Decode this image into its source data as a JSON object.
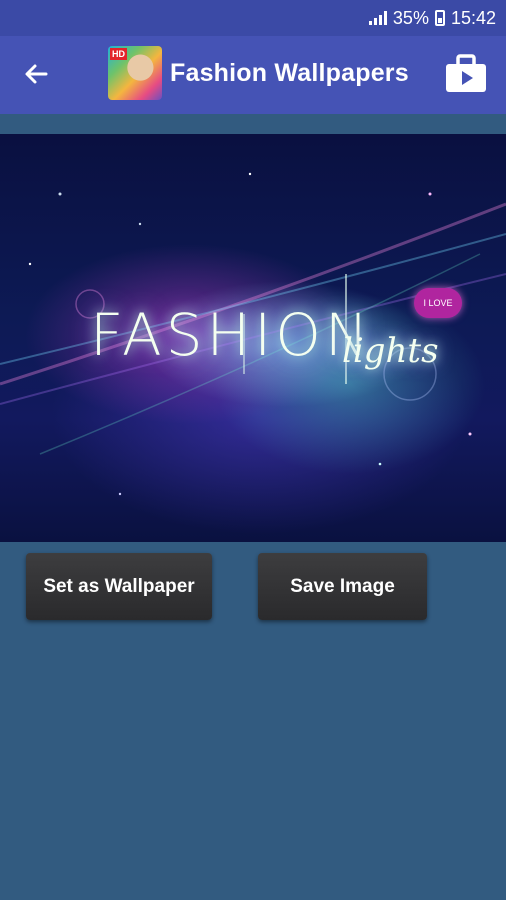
{
  "status_bar": {
    "battery": "35%",
    "time": "15:42"
  },
  "app_bar": {
    "title": "Fashion Wallpapers",
    "logo_badge": "HD"
  },
  "wallpaper": {
    "title": "FASHION",
    "subtitle": "lights",
    "badge": "I LOVE"
  },
  "actions": {
    "set_wallpaper": "Set as Wallpaper",
    "save_image": "Save Image"
  },
  "colors": {
    "status_bar": "#3b4aa6",
    "app_bar": "#4553b5",
    "background": "#325b80",
    "button": "#333335"
  },
  "icons": {
    "back": "arrow-left-icon",
    "share": "share-briefcase-icon"
  }
}
